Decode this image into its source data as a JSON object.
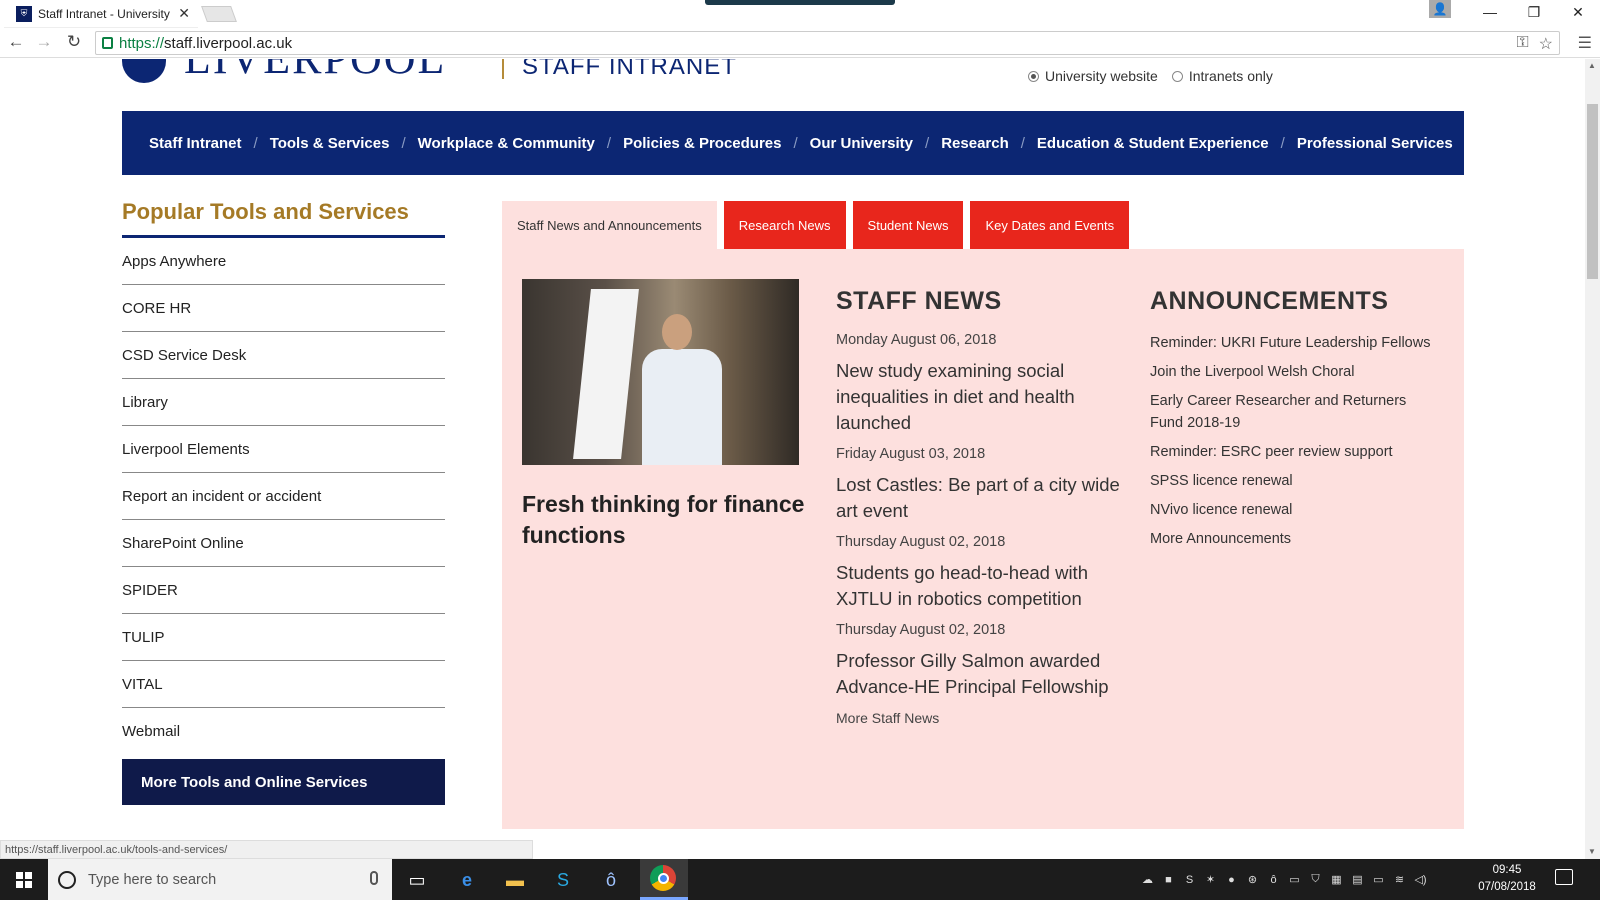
{
  "browser": {
    "tab_title": "Staff Intranet - University",
    "tab_close": "✕",
    "url_scheme": "https://",
    "url_rest": "staff.liverpool.ac.uk",
    "status_url": "https://staff.liverpool.ac.uk/tools-and-services/"
  },
  "header": {
    "logo_text": "LIVERPOOL",
    "site_title": "STAFF INTRANET",
    "radio_university": "University website",
    "radio_intranets": "Intranets only"
  },
  "nav": {
    "items": [
      "Staff Intranet",
      "Tools & Services",
      "Workplace & Community",
      "Policies & Procedures",
      "Our University",
      "Research",
      "Education & Student Experience",
      "Professional Services"
    ]
  },
  "sidebar": {
    "title": "Popular Tools and Services",
    "items": [
      "Apps Anywhere",
      "CORE HR",
      "CSD Service Desk",
      "Library",
      "Liverpool Elements",
      "Report an incident or accident",
      "SharePoint Online",
      "SPIDER",
      "TULIP",
      "VITAL",
      "Webmail"
    ],
    "more_button": "More Tools and Online Services"
  },
  "news_tabs": [
    "Staff News and Announcements",
    "Research News",
    "Student News",
    "Key Dates and Events"
  ],
  "feature": {
    "title": "Fresh thinking for finance functions"
  },
  "staff_news": {
    "heading": "STAFF NEWS",
    "items": [
      {
        "date": "Monday August 06, 2018",
        "title": "New study examining social inequalities in diet and health launched"
      },
      {
        "date": "Friday August 03, 2018",
        "title": "Lost Castles: Be part of a city wide art event"
      },
      {
        "date": "Thursday August 02, 2018",
        "title": "Students go head-to-head with XJTLU in robotics competition"
      },
      {
        "date": "Thursday August 02, 2018",
        "title": "Professor Gilly Salmon awarded Advance-HE Principal Fellowship"
      }
    ],
    "more": "More Staff News"
  },
  "announcements": {
    "heading": "ANNOUNCEMENTS",
    "items": [
      "Reminder: UKRI Future Leadership Fellows",
      "Join the Liverpool Welsh Choral",
      "Early Career Researcher and Returners Fund 2018-19",
      "Reminder: ESRC peer review support",
      "SPSS licence renewal",
      "NVivo licence renewal"
    ],
    "more": "More Announcements"
  },
  "taskbar": {
    "search_placeholder": "Type here to search",
    "time": "09:45",
    "date": "07/08/2018"
  },
  "colors": {
    "navy": "#0c2673",
    "gold": "#a57a26",
    "tab_red": "#e8261c",
    "panel_pink": "#fde0de"
  },
  "icons": [
    "back-icon",
    "forward-icon",
    "reload-icon",
    "lock-icon",
    "key-icon",
    "star-icon",
    "menu-icon",
    "windows-start-icon",
    "cortana-icon",
    "microphone-icon",
    "task-view-icon",
    "edge-icon",
    "file-explorer-icon",
    "skype-icon",
    "chrome-icon"
  ]
}
